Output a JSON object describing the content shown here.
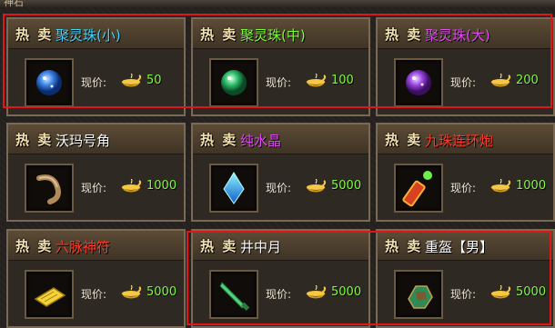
{
  "window": {
    "title": "神石"
  },
  "hot_label": "热 卖",
  "price_label": "现价:",
  "colors": {
    "green": "#7cfb3c",
    "cyan": "#3fd7ff",
    "magenta": "#e24bf2",
    "red": "#ff3b2a",
    "white": "#ffffff",
    "highlight": "#e21616"
  },
  "items": [
    {
      "name": "聚灵珠(小)",
      "name_color": "#3fd7ff",
      "price": "50",
      "icon": "blue-orb-icon"
    },
    {
      "name": "聚灵珠(中)",
      "name_color": "#7cfb3c",
      "price": "100",
      "icon": "green-orb-icon"
    },
    {
      "name": "聚灵珠(大)",
      "name_color": "#e24bf2",
      "price": "200",
      "icon": "purple-orb-icon"
    },
    {
      "name": "沃玛号角",
      "name_color": "#ffffff",
      "price": "1000",
      "icon": "horn-icon"
    },
    {
      "name": "纯水晶",
      "name_color": "#e24bf2",
      "price": "5000",
      "icon": "crystal-icon"
    },
    {
      "name": "九珠连环炮",
      "name_color": "#ff3b2a",
      "price": "1000",
      "icon": "cannon-icon"
    },
    {
      "name": "六脉神符",
      "name_color": "#ff3b2a",
      "price": "5000",
      "icon": "scroll-icon"
    },
    {
      "name": "井中月",
      "name_color": "#ffffff",
      "price": "5000",
      "icon": "blade-icon"
    },
    {
      "name": "重盔【男】",
      "name_color": "#ffffff",
      "price": "5000",
      "icon": "armor-icon"
    }
  ]
}
